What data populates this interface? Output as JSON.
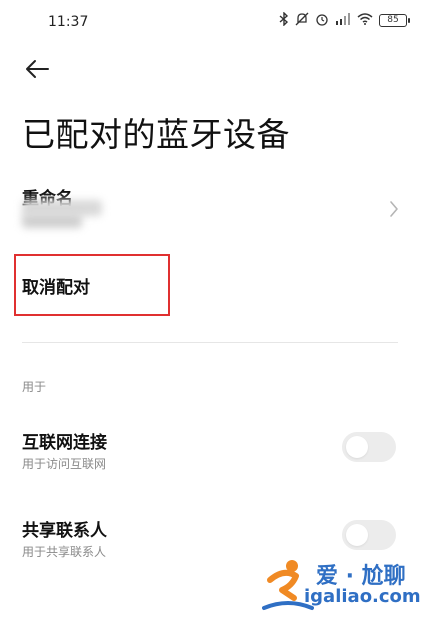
{
  "status_bar": {
    "time": "11:37",
    "battery": "85",
    "icons": [
      "bluetooth-icon",
      "mute-icon",
      "alarm-icon",
      "signal-icon",
      "wifi-icon",
      "battery-icon"
    ]
  },
  "header": {
    "title": "已配对的蓝牙设备"
  },
  "rename": {
    "label": "重命名"
  },
  "unpair": {
    "label": "取消配对"
  },
  "section": {
    "label": "用于"
  },
  "settings": [
    {
      "title": "互联网连接",
      "subtitle": "用于访问互联网",
      "enabled": false
    },
    {
      "title": "共享联系人",
      "subtitle": "用于共享联系人",
      "enabled": false
    }
  ],
  "watermark": {
    "title": "爱 · 尬聊",
    "url": "igaliao.com"
  },
  "colors": {
    "highlight": "#e03030",
    "watermark": "#2f6fc4",
    "toggle_off": "#ececec"
  }
}
